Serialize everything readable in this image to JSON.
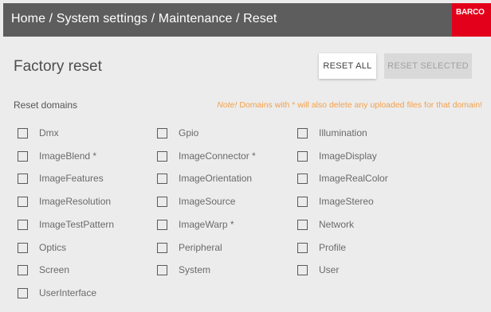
{
  "header": {
    "breadcrumb": "Home / System settings / Maintenance / Reset",
    "logo_text": "BARCO",
    "accent_color": "#e2001a"
  },
  "page": {
    "title": "Factory reset",
    "reset_all_label": "RESET ALL",
    "reset_selected_label": "RESET SELECTED",
    "domains_label": "Reset domains",
    "note_prefix": "Note!",
    "note_text": " Domains with * will also delete any uploaded files for that domain!",
    "note_color": "#f5a04a"
  },
  "domains": [
    {
      "label": "Dmx",
      "checked": false
    },
    {
      "label": "Gpio",
      "checked": false
    },
    {
      "label": "Illumination",
      "checked": false
    },
    {
      "label": "ImageBlend *",
      "checked": false
    },
    {
      "label": "ImageConnector *",
      "checked": false
    },
    {
      "label": "ImageDisplay",
      "checked": false
    },
    {
      "label": "ImageFeatures",
      "checked": false
    },
    {
      "label": "ImageOrientation",
      "checked": false
    },
    {
      "label": "ImageRealColor",
      "checked": false
    },
    {
      "label": "ImageResolution",
      "checked": false
    },
    {
      "label": "ImageSource",
      "checked": false
    },
    {
      "label": "ImageStereo",
      "checked": false
    },
    {
      "label": "ImageTestPattern",
      "checked": false
    },
    {
      "label": "ImageWarp *",
      "checked": false
    },
    {
      "label": "Network",
      "checked": false
    },
    {
      "label": "Optics",
      "checked": false
    },
    {
      "label": "Peripheral",
      "checked": false
    },
    {
      "label": "Profile",
      "checked": false
    },
    {
      "label": "Screen",
      "checked": false
    },
    {
      "label": "System",
      "checked": false
    },
    {
      "label": "User",
      "checked": false
    },
    {
      "label": "UserInterface",
      "checked": false
    }
  ]
}
